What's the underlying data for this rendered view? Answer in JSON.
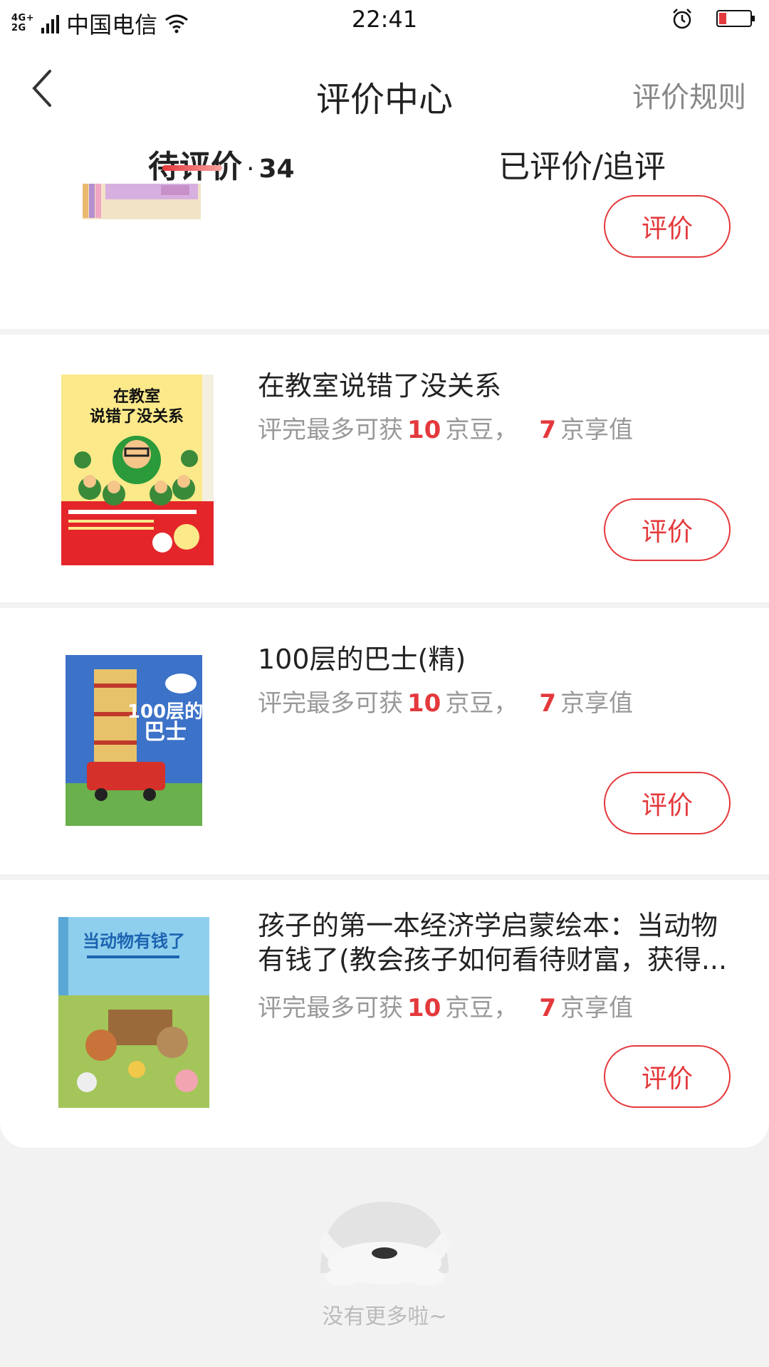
{
  "status_bar": {
    "network_top": "4G+",
    "network_bottom": "2G",
    "carrier": "中国电信",
    "time": "22:41"
  },
  "header": {
    "title": "评价中心",
    "rules_link": "评价规则"
  },
  "tabs": {
    "pending_label": "待评价",
    "pending_separator": "·",
    "pending_count": "34",
    "reviewed_label": "已评价/追评"
  },
  "products": [
    {
      "title": "在教室说错了没关系",
      "reward_prefix": "评完最多可获",
      "beans": "10",
      "beans_unit": "京豆，",
      "value": "7",
      "value_unit": "京享值",
      "button": "评价",
      "cover_text": "在教室说错了没关系"
    },
    {
      "title": "100层的巴士(精)",
      "reward_prefix": "评完最多可获",
      "beans": "10",
      "beans_unit": "京豆，",
      "value": "7",
      "value_unit": "京享值",
      "button": "评价",
      "cover_text": "100层的巴士"
    },
    {
      "title": "孩子的第一本经济学启蒙绘本：当动物有钱了(教会孩子如何看待财富，获得...",
      "reward_prefix": "评完最多可获",
      "beans": "10",
      "beans_unit": "京豆，",
      "value": "7",
      "value_unit": "京享值",
      "button": "评价",
      "cover_text": "当动物有钱了"
    }
  ],
  "partial_card": {
    "button": "评价"
  },
  "footer": {
    "no_more": "没有更多啦~"
  },
  "colors": {
    "accent": "#e4393c",
    "muted": "#999999"
  }
}
